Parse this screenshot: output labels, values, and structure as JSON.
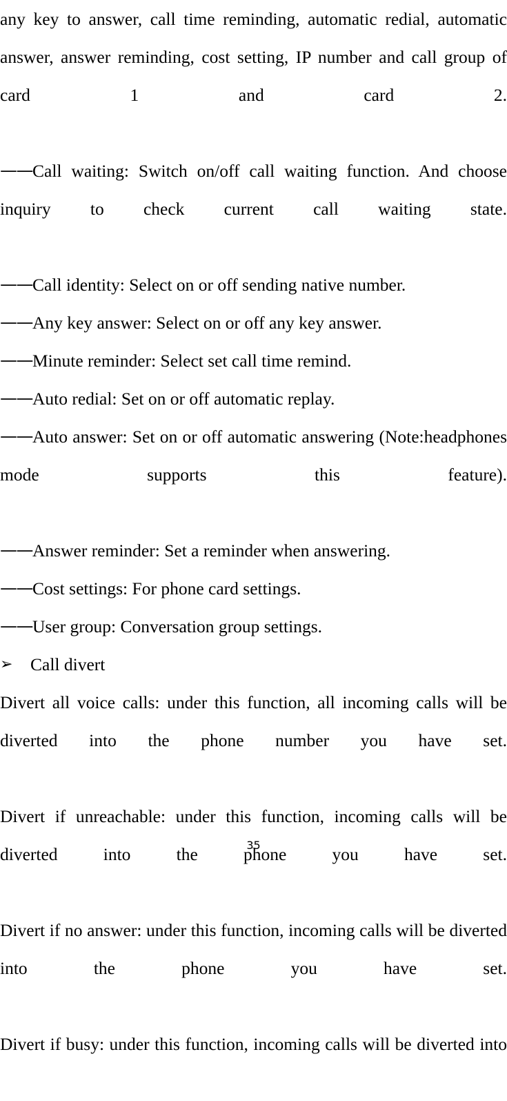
{
  "document": {
    "page_number": "35",
    "dash_prefix": "——",
    "arrow_bullet": "➢"
  },
  "content": {
    "paragraph_continuation": "any key to answer, call time reminding, automatic redial, automatic answer, answer reminding, cost setting, IP number and call group of card 1 and card 2.",
    "dash_items": [
      "Call waiting: Switch on/off call waiting function. And choose inquiry to check current call waiting state.",
      "Call identity: Select on or off sending native number.",
      "Any key answer: Select on or off any key answer.",
      "Minute reminder: Select set call time remind.",
      "Auto redial: Set on or off automatic replay.",
      "Auto answer: Set on or off automatic answering (Note:headphones mode supports this feature).",
      "Answer reminder: Set a reminder when answering.",
      "Cost settings: For phone card settings.",
      "User group: Conversation group settings."
    ],
    "section_heading": "Call divert",
    "divert_paragraphs": [
      "Divert all voice calls: under this function, all incoming calls will be diverted into the phone number you have set.",
      "Divert if unreachable: under this function, incoming calls will be diverted into the phone you have set.",
      "Divert if no answer: under this function, incoming calls will be diverted into the phone you have set.",
      "Divert if busy: under this function, incoming calls will be diverted into"
    ]
  }
}
